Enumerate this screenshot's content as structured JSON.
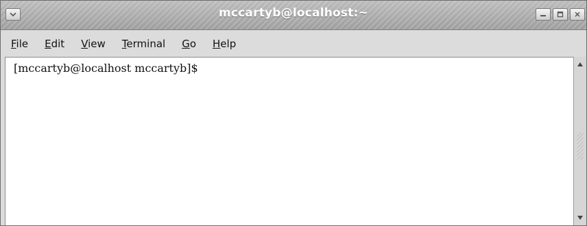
{
  "window": {
    "title": "mccartyb@localhost:~"
  },
  "menubar": {
    "items": [
      {
        "accel": "F",
        "rest": "ile"
      },
      {
        "accel": "E",
        "rest": "dit"
      },
      {
        "accel": "V",
        "rest": "iew"
      },
      {
        "accel": "T",
        "rest": "erminal"
      },
      {
        "accel": "G",
        "rest": "o"
      },
      {
        "accel": "H",
        "rest": "elp"
      }
    ]
  },
  "terminal": {
    "prompt": "[mccartyb@localhost mccartyb]$"
  },
  "icons": {
    "window_menu": "chevron-down-icon",
    "minimize": "minimize-icon",
    "maximize": "maximize-icon",
    "close": "close-icon",
    "scroll_up": "arrow-up-icon",
    "scroll_down": "arrow-down-icon"
  },
  "colors": {
    "titlebar": "#a8a8a8",
    "title_text": "#ffffff",
    "menubar": "#dcdcdc",
    "terminal_bg": "#ffffff",
    "terminal_text": "#111111"
  }
}
